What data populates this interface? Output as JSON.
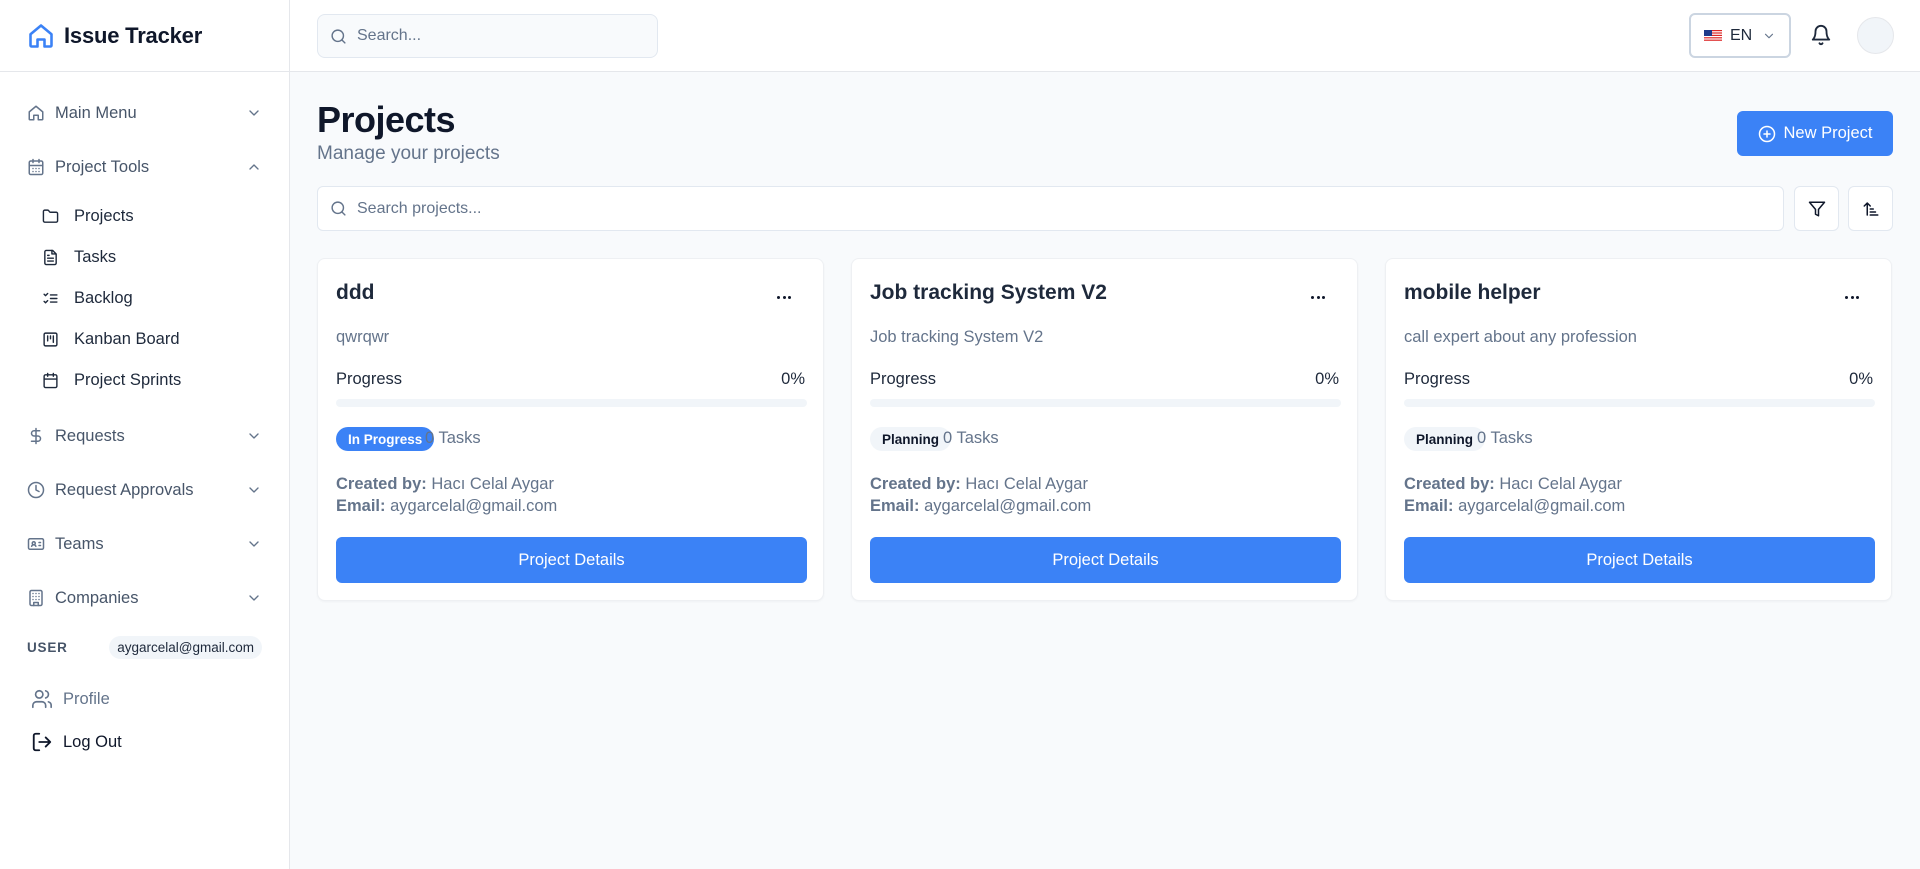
{
  "app": {
    "title": "Issue Tracker"
  },
  "sidebar": {
    "groups": [
      {
        "label": "Main Menu",
        "icon": "home-icon"
      },
      {
        "label": "Project Tools",
        "icon": "calendar-icon",
        "expanded": true
      },
      {
        "label": "Requests",
        "icon": "dollar-icon"
      },
      {
        "label": "Request Approvals",
        "icon": "clock-icon"
      },
      {
        "label": "Teams",
        "icon": "id-card-icon"
      },
      {
        "label": "Companies",
        "icon": "building-icon"
      }
    ],
    "project_tools": [
      {
        "label": "Projects",
        "icon": "folder-icon"
      },
      {
        "label": "Tasks",
        "icon": "file-icon"
      },
      {
        "label": "Backlog",
        "icon": "list-check-icon"
      },
      {
        "label": "Kanban Board",
        "icon": "kanban-icon"
      },
      {
        "label": "Project Sprints",
        "icon": "calendar-icon"
      }
    ],
    "user_label": "USER",
    "user_email": "aygarcelal@gmail.com",
    "profile_label": "Profile",
    "logout_label": "Log Out"
  },
  "topbar": {
    "search_placeholder": "Search...",
    "language": "EN"
  },
  "main": {
    "title": "Projects",
    "subtitle": "Manage your projects",
    "new_project_label": "New Project",
    "search_placeholder": "Search projects..."
  },
  "projects": [
    {
      "name": "ddd",
      "description": "qwrqwr",
      "progress_label": "Progress",
      "progress": "0%",
      "progress_fraction": 0,
      "status": "In Progress",
      "tasks": "0 Tasks",
      "created_by_label": "Created by:",
      "created_by": "Hacı Celal Aygar",
      "email_label": "Email:",
      "email": "aygarcelal@gmail.com",
      "details_label": "Project Details"
    },
    {
      "name": "Job tracking System V2",
      "description": "Job tracking System V2",
      "progress_label": "Progress",
      "progress": "0%",
      "progress_fraction": 0,
      "status": "Planning",
      "tasks": "0 Tasks",
      "created_by_label": "Created by:",
      "created_by": "Hacı Celal Aygar",
      "email_label": "Email:",
      "email": "aygarcelal@gmail.com",
      "details_label": "Project Details"
    },
    {
      "name": "mobile helper",
      "description": "call expert about any profession",
      "progress_label": "Progress",
      "progress": "0%",
      "progress_fraction": 0,
      "status": "Planning",
      "tasks": "0 Tasks",
      "created_by_label": "Created by:",
      "created_by": "Hacı Celal Aygar",
      "email_label": "Email:",
      "email": "aygarcelal@gmail.com",
      "details_label": "Project Details"
    }
  ],
  "colors": {
    "accent": "#3b82f6",
    "text": "#0f172a",
    "muted": "#64748b",
    "background": "#f8fafc"
  }
}
